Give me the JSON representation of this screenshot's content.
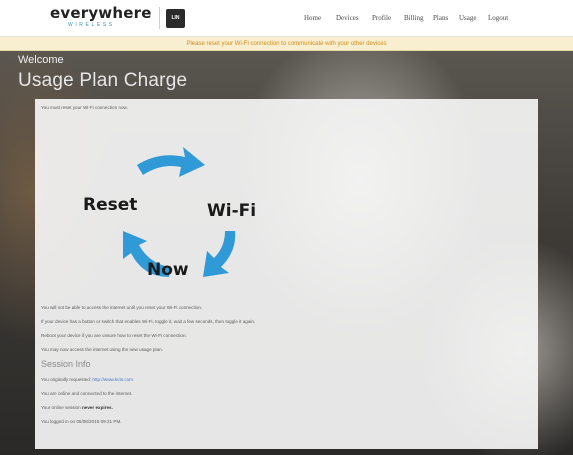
{
  "header": {
    "logo_word": "everywhere",
    "logo_tag": "WIRELESS",
    "partner_logo": "LIN",
    "nav": [
      "Home",
      "Devices",
      "Profile",
      "Billing",
      "Plans",
      "Usage",
      "Logout"
    ]
  },
  "notice": "Please reset your Wi-Fi connection to communicate with your other devices",
  "welcome": "Welcome",
  "page_title": "Usage Plan Charge",
  "intro": "You must reset your Wi-Fi connection now.",
  "graphic": {
    "words": [
      "Reset",
      "Wi-Fi",
      "Now"
    ],
    "arrow_color": "#2f9ad6"
  },
  "instructions": [
    "You will not be able to access the internet until you reset your Wi-Fi connection.",
    "If your device has a button or switch that enables Wi-Fi, toggle it, wait a few seconds, then toggle it again.",
    "Reboot your device if you are unsure how to reset the Wi-Fi connection.",
    "You may now access the internet using the new usage plan."
  ],
  "session": {
    "title": "Session Info",
    "requested_prefix": "You originally requested:",
    "requested_url": "http://www.kcts.com",
    "online_text": "You are online and connected to the internet.",
    "expires_prefix": "Your online session",
    "expires_value": "never expires.",
    "login_text": "You logged in on 06/08/2019 09:21 PM."
  }
}
